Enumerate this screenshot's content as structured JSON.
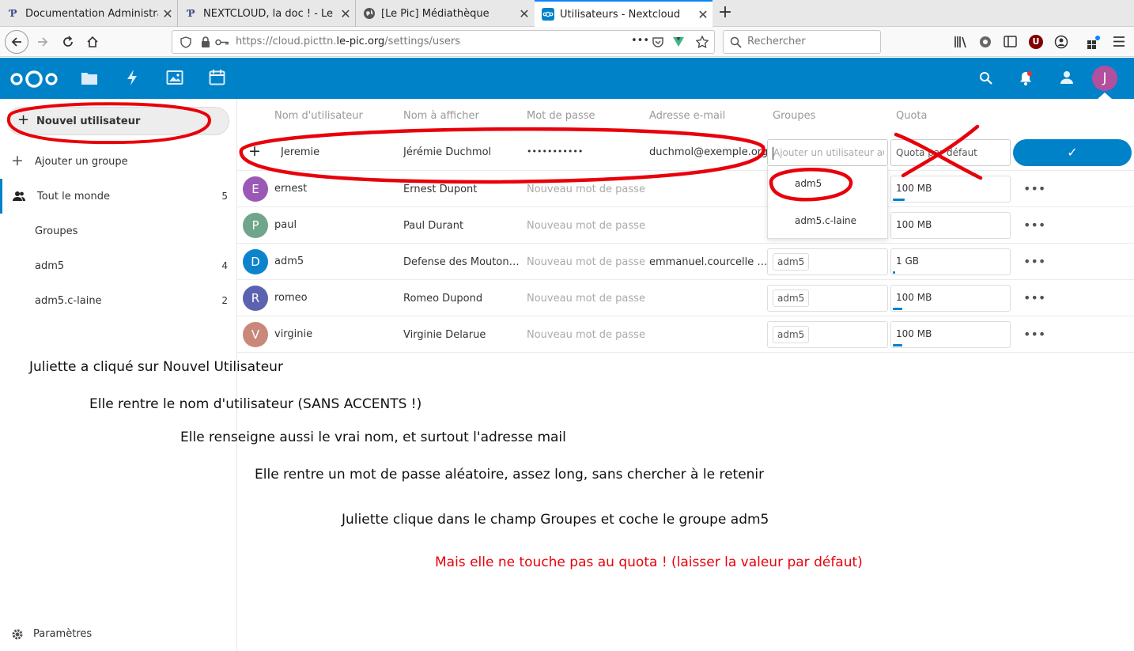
{
  "browser": {
    "tabs": [
      {
        "title": "Documentation Administra",
        "favicon": "P"
      },
      {
        "title": "NEXTCLOUD, la doc ! - Le Pi",
        "favicon": "P"
      },
      {
        "title": "[Le Pic] Médiathèque",
        "favicon": "globe"
      },
      {
        "title": "Utilisateurs - Nextcloud",
        "favicon": "nextcloud",
        "active": true
      }
    ],
    "close_glyph": "✕",
    "new_tab_glyph": "+",
    "url_prefix": "https://cloud.picttn.",
    "url_domain": "le-pic.org",
    "url_suffix": "/settings/users",
    "url_more": "•••",
    "search_placeholder": "Rechercher",
    "addon_badge": "U"
  },
  "nextcloud": {
    "accent": "#0082c9",
    "avatar_letter": "J"
  },
  "sidebar": {
    "new_user": "Nouvel utilisateur",
    "add_group": "Ajouter un groupe",
    "everyone": {
      "label": "Tout le monde",
      "count": "5"
    },
    "groups_heading": "Groupes",
    "groups": [
      {
        "label": "adm5",
        "count": "4"
      },
      {
        "label": "adm5.c-laine",
        "count": "2"
      }
    ],
    "settings": "Paramètres"
  },
  "table": {
    "headers": {
      "username": "Nom d'utilisateur",
      "display_name": "Nom à afficher",
      "password": "Mot de passe",
      "email": "Adresse e-mail",
      "groups": "Groupes",
      "quota": "Quota"
    },
    "new_row": {
      "plus": "+",
      "username": "Jeremie",
      "display_name": "Jérémie Duchmol",
      "password": "•••••••••••",
      "email": "duchmol@exemple.org",
      "groups_placeholder": "Ajouter un utilisateur au",
      "quota_placeholder": "Quota par défaut",
      "submit_glyph": "✓"
    },
    "group_dropdown": [
      "adm5",
      "adm5.c-laine"
    ],
    "users": [
      {
        "avatar": "E",
        "color": "#9b59b6",
        "username": "ernest",
        "display_name": "Ernest Dupont",
        "password": "Nouveau mot de passe",
        "email": "",
        "group": "",
        "quota": "100 MB",
        "used": 0.1
      },
      {
        "avatar": "P",
        "color": "#6fa58b",
        "username": "paul",
        "display_name": "Paul Durant",
        "password": "Nouveau mot de passe",
        "email": "",
        "group": "",
        "quota": "100 MB",
        "used": 0
      },
      {
        "avatar": "D",
        "color": "#0e83cd",
        "username": "adm5",
        "display_name": "Defense des Mouton…",
        "password": "Nouveau mot de passe",
        "email": "emmanuel.courcelle …",
        "group": "adm5",
        "quota": "1 GB",
        "used": 0.02
      },
      {
        "avatar": "R",
        "color": "#5b63b0",
        "username": "romeo",
        "display_name": "Romeo Dupond",
        "password": "Nouveau mot de passe",
        "email": "",
        "group": "adm5",
        "quota": "100 MB",
        "used": 0.08
      },
      {
        "avatar": "V",
        "color": "#c9887a",
        "username": "virginie",
        "display_name": "Virginie Delarue",
        "password": "Nouveau mot de passe",
        "email": "",
        "group": "adm5",
        "quota": "100 MB",
        "used": 0.08
      }
    ],
    "more_glyph": "•••"
  },
  "notes": [
    "Juliette a cliqué sur Nouvel Utilisateur",
    "Elle rentre le nom d'utilisateur (SANS ACCENTS !)",
    "Elle renseigne aussi le vrai nom, et surtout l'adresse mail",
    "Elle rentre un mot de passe aléatoire, assez long, sans chercher à le retenir",
    "Juliette clique dans le champ Groupes et coche le groupe adm5",
    "Mais elle ne touche pas au quota ! (laisser la valeur par défaut)"
  ],
  "annotation_color": "#e8000b"
}
